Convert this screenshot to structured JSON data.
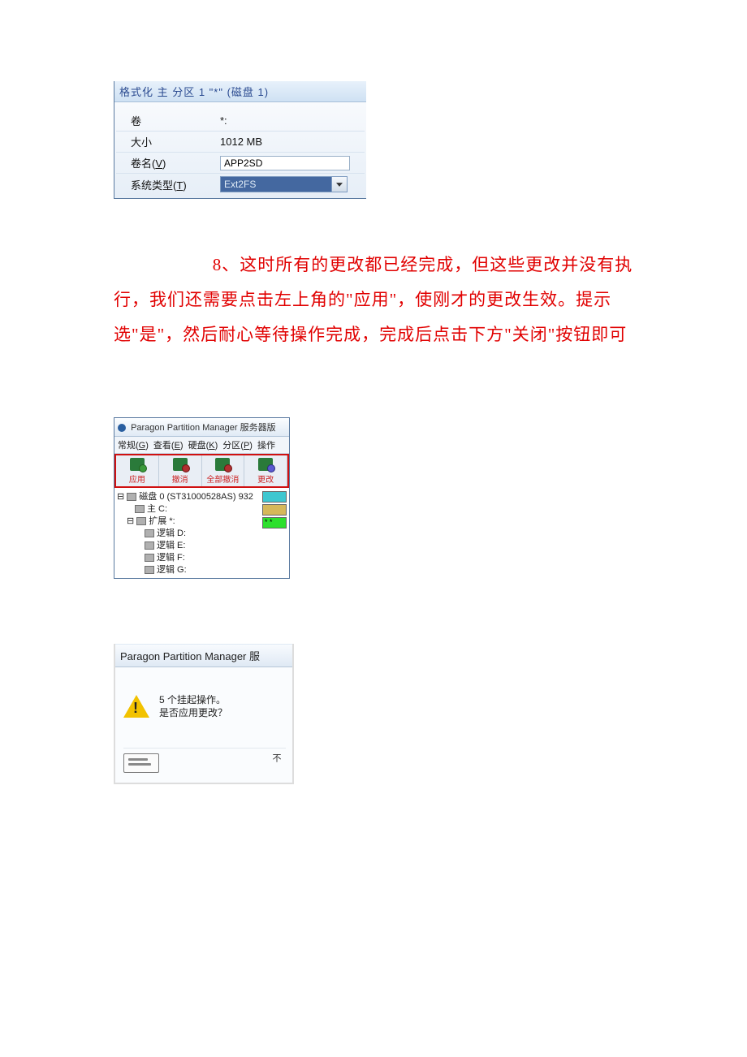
{
  "dlg1": {
    "title": "格式化 主 分区 1 \"*\" (磁盘 1)",
    "rows": {
      "volume_label": "卷",
      "volume_value": "*:",
      "size_label": "大小",
      "size_value": "1012 MB",
      "name_label_prefix": "卷名",
      "name_label_hint": "V",
      "name_value": "APP2SD",
      "type_label_prefix": "系统类型",
      "type_label_hint": "T",
      "type_value": "Ext2FS"
    }
  },
  "paragraph": "8、这时所有的更改都已经完成，但这些更改并没有执行，我们还需要点击左上角的\"应用\"，使刚才的更改生效。提示选\"是\"，然后耐心等待操作完成，完成后点击下方\"关闭\"按钮即可",
  "app": {
    "title": "Paragon Partition Manager 服务器版",
    "menu": {
      "general_prefix": "常规",
      "general_hint": "G",
      "view_prefix": "查看",
      "view_hint": "E",
      "disk_prefix": "硬盘",
      "disk_hint": "K",
      "part_prefix": "分区",
      "part_hint": "P",
      "op_prefix": "操作"
    },
    "toolbar": {
      "apply": "应用",
      "undo": "撤消",
      "undo_all": "全部撤消",
      "modify": "更改"
    },
    "tree": {
      "disk0": "磁盘 0 (ST31000528AS) 932",
      "main_c": "主 C:",
      "ext": "扩展 *:",
      "logic_d": "逻辑 D:",
      "logic_e": "逻辑 E:",
      "logic_f": "逻辑 F:",
      "logic_g": "逻辑 G:"
    }
  },
  "confirm": {
    "title": "Paragon Partition Manager 服",
    "line1": "5 个挂起操作。",
    "line2": "是否应用更改？",
    "vert": "不"
  }
}
